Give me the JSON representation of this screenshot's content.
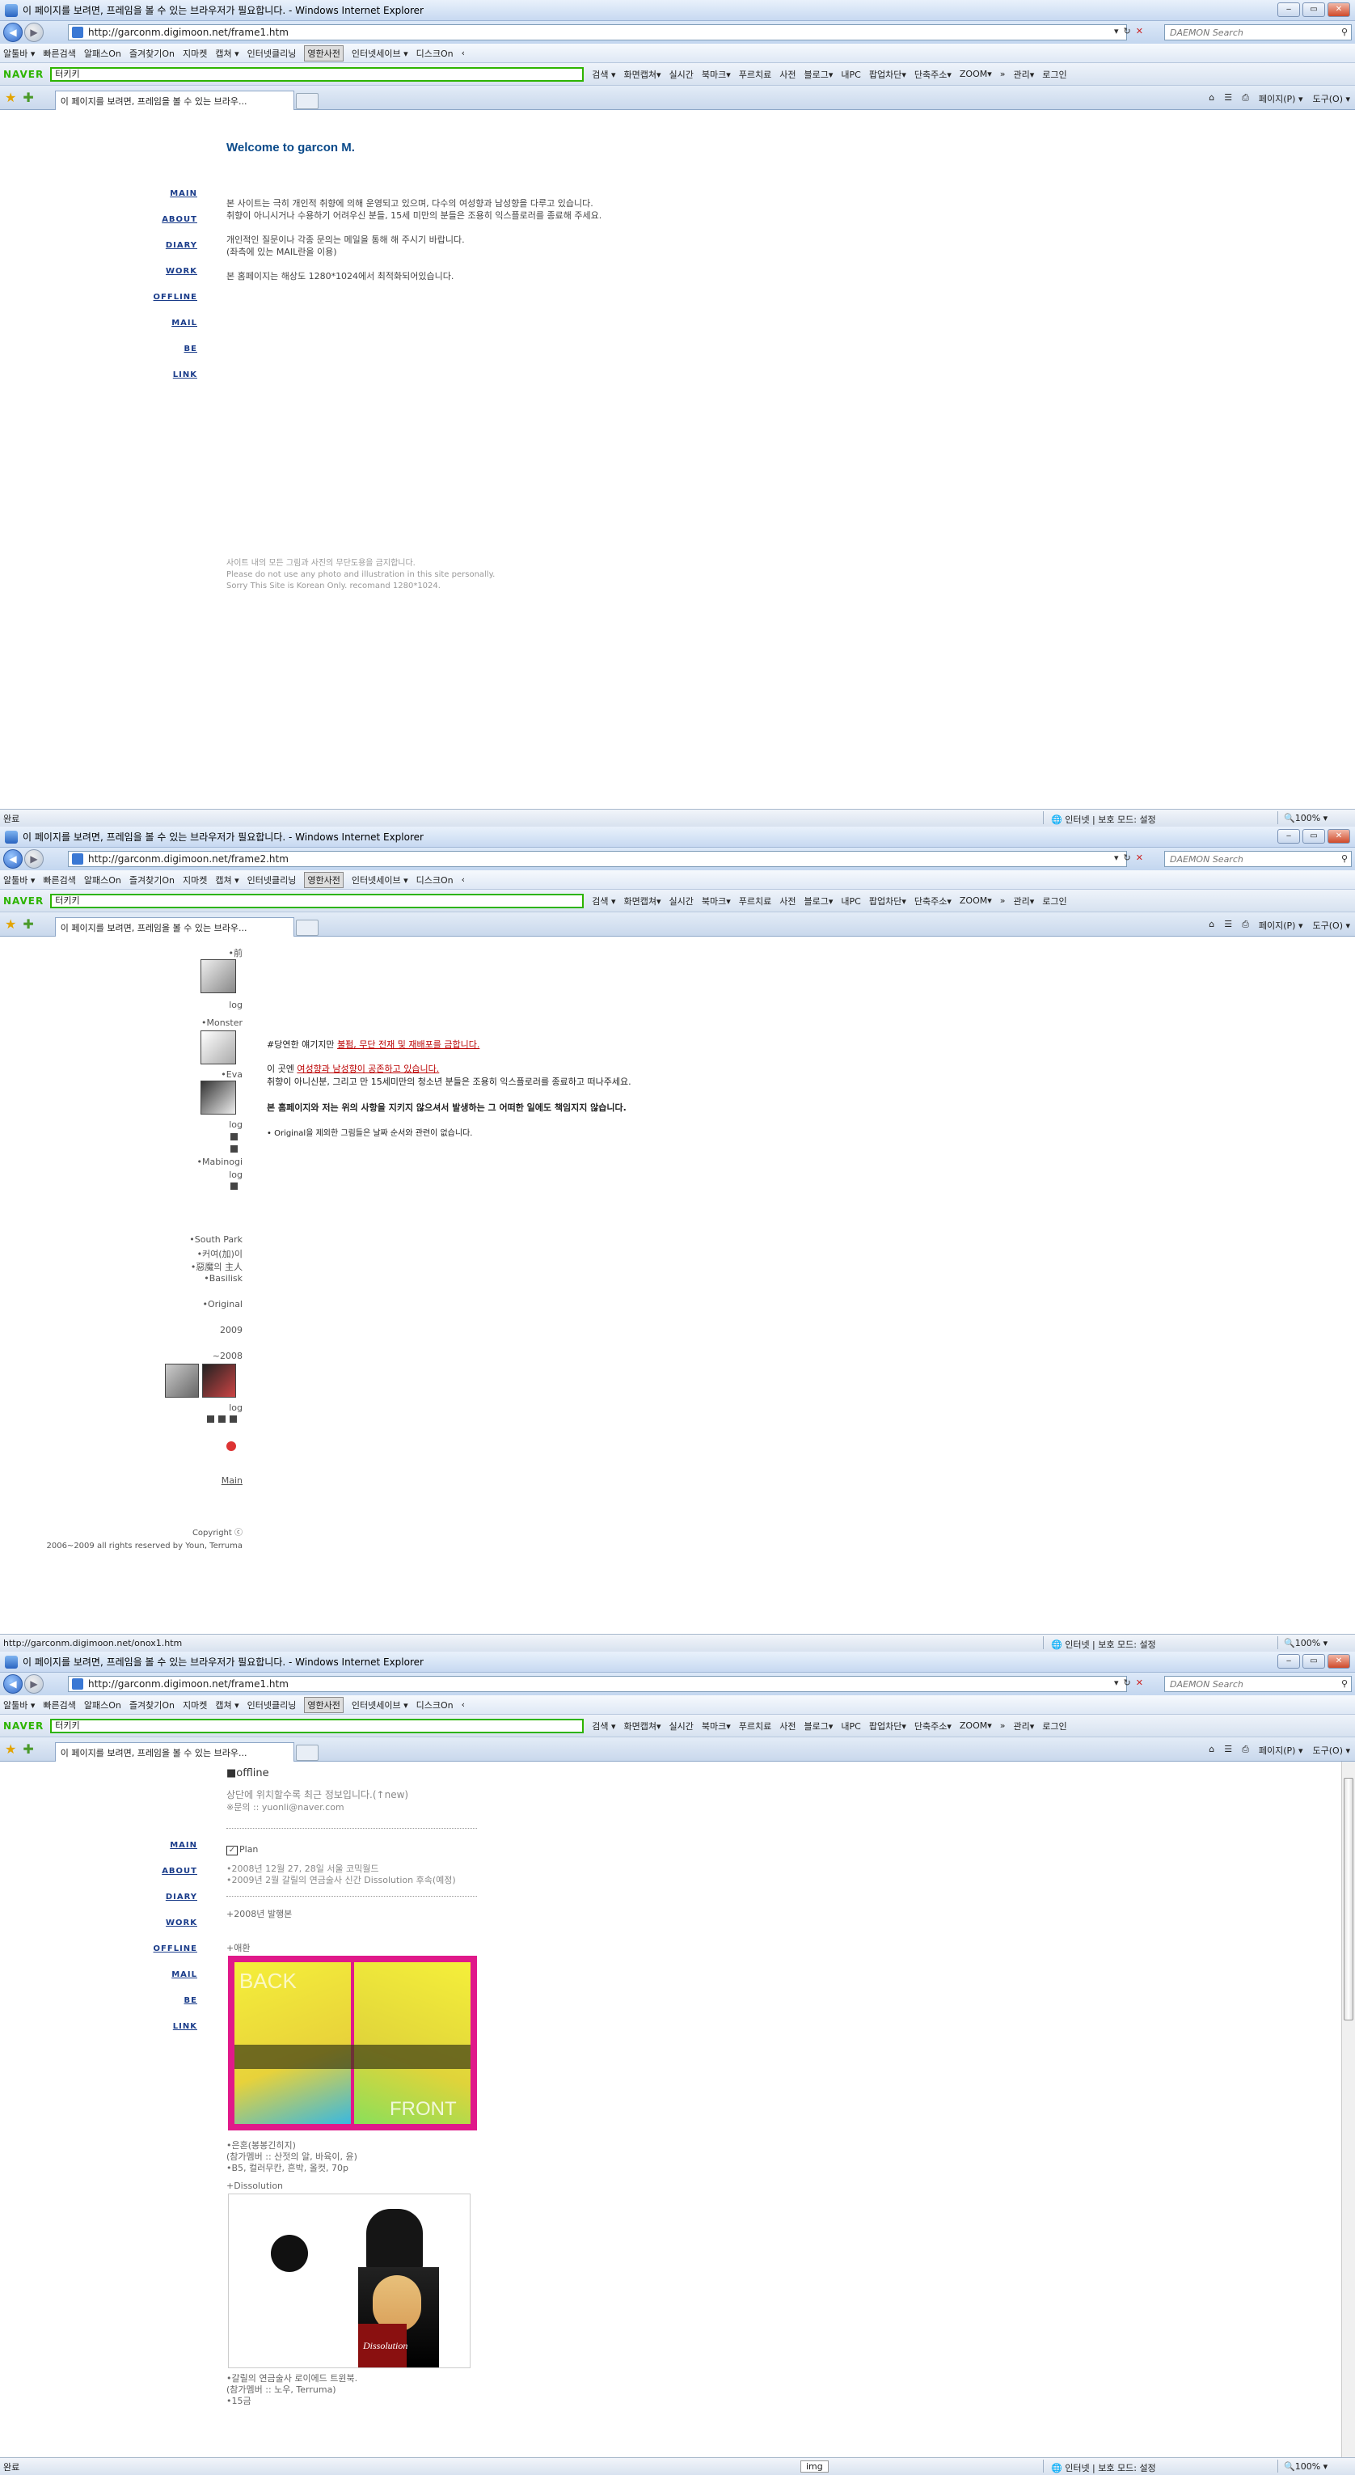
{
  "window1": {
    "title": "이 페이지를 보려면, 프레임을 볼 수 있는 브라우저가 필요합니다. - Windows Internet Explorer",
    "url": "http://garconm.digimoon.net/frame1.htm",
    "search_placeholder": "DAEMON Search",
    "tab_label": "이 페이지를 보려면, 프레임을 볼 수 있는 브라우...",
    "status_text": "완료",
    "zone": "인터넷 | 보호 모드: 설정",
    "zoom": "100%"
  },
  "window2": {
    "title": "이 페이지를 보려면, 프레임을 볼 수 있는 브라우저가 필요합니다. - Windows Internet Explorer",
    "url": "http://garconm.digimoon.net/frame2.htm",
    "search_placeholder": "DAEMON Search",
    "tab_label": "이 페이지를 보려면, 프레임을 볼 수 있는 브라우...",
    "status_text": "http://garconm.digimoon.net/onox1.htm",
    "zone": "인터넷 | 보호 모드: 설정",
    "zoom": "100%"
  },
  "window3": {
    "title": "이 페이지를 보려면, 프레임을 볼 수 있는 브라우저가 필요합니다. - Windows Internet Explorer",
    "url": "http://garconm.digimoon.net/frame1.htm",
    "search_placeholder": "DAEMON Search",
    "tab_label": "이 페이지를 보려면, 프레임을 볼 수 있는 브라우...",
    "status_text": "완료",
    "status_img": "img",
    "zone": "인터넷 | 보호 모드: 설정",
    "zoom": "100%"
  },
  "toolbar1": [
    "알툴바 ▾",
    "빠른검색",
    "알패스On",
    "즐겨찾기On",
    "지마켓",
    "캡쳐 ▾",
    "인터넷클리닝",
    "영한사전",
    "인터넷세이브 ▾",
    "디스크On",
    "‹"
  ],
  "toolbar2": {
    "brand": "NAVER",
    "query": "터키키",
    "items": [
      "검색 ▾",
      "화면캡쳐▾",
      "실시간",
      "북마크▾",
      "푸르치료",
      "사전",
      "블로그▾",
      "내PC",
      "팝업차단▾",
      "단축주소▾",
      "ZOOM▾",
      "»",
      "관리▾",
      "로그인"
    ]
  },
  "cmdbar": [
    "페이지(P) ▾",
    "도구(O) ▾"
  ],
  "menu": [
    "MAIN",
    "ABOUT",
    "DIARY",
    "WORK",
    "OFFLINE",
    "MAIL",
    "BE",
    "LINK"
  ],
  "page1": {
    "welcome": "Welcome to garcon M.",
    "para1": "본 사이트는 극히 개인적 취향에 의해 운영되고 있으며, 다수의 여성향과 남성향을 다루고 있습니다.",
    "para2": "취향이 아니시거나 수용하기 어려우신 분들, 15세 미만의 분들은 조용히 익스플로러를 종료해 주세요.",
    "para3": "개인적인 질문이나 각종 문의는 메일을 통해 해 주시기 바랍니다.",
    "para4": "(좌측에 있는 MAIL란을 이용)",
    "para5": "본 홈페이지는 해상도 1280*1024에서 최적화되어있습니다.",
    "foot1": "사이트 내의 모든 그림과 사진의 무단도용을 금지합니다.",
    "foot2": "Please do not use any photo and illustration in this site personally.",
    "foot3": "Sorry This Site is Korean Only. recomand 1280*1024."
  },
  "page2": {
    "left": {
      "l1": "•前",
      "l2": "log",
      "l3": "•Monster",
      "l4": "•Eva",
      "l5": "log",
      "l6": "•Mabinogi",
      "l7": "log",
      "l8": "•South Park",
      "l9": "•커여(加)이",
      "l10": "•惡魔의 主人",
      "l11": "•Basilisk",
      "l12": "•Original",
      "l13": "2009",
      "l14": "~2008",
      "l15": "log",
      "l16": "Main",
      "copy1": "Copyright ⓒ",
      "copy2": "2006~2009 all rights reserved by Youn, Terruma"
    },
    "notice1a": "#당연한 얘기지만 ",
    "notice1b": "불펌, 무단 전재 및 재배포를 금합니다.",
    "notice2a": "이 곳엔 ",
    "notice2b": "여성향과 남성향이 공존하고 있습니다.",
    "notice3": "취향이 아니신분, 그리고 만 15세미만의 청소년 분들은 조용히 익스플로러를 종료하고 떠나주세요.",
    "notice4": "본 홈페이지와 저는 위의 사항을 지키지 않으셔서 발생하는 그 어떠한 일에도 책임지지 않습니다.",
    "notice5": "• Original을 제외한 그림들은 날짜 순서와 관련이 없습니다."
  },
  "page3": {
    "heading": "■offline",
    "sub": "상단에 위치할수록 최근 정보입니다.(↑new)",
    "contact": "※문의 :: yuonli@naver.com",
    "plan": "Plan",
    "plan1": "•2008년 12월 27, 28일 서울 코믹월드",
    "plan2": "•2009년 2월 갈릴의 연금술사 신간 Dissolution 후속(예정)",
    "issue": "+2008년 발행본",
    "book1": "+애환",
    "book1_img_front": "FRONT",
    "book1_img_back": "BACK",
    "book1_d1": "•은혼(봉봉긴히지)",
    "book1_d2": "(참가멤버 :: 산젓의 알, 바육이, 윤)",
    "book1_d3": "•B5, 컬러무칸, 흔박, 올컷, 70p",
    "book2": "+Dissolution",
    "book2_img_title": "Dissolution",
    "book2_d1": "•갈릴의 연금술사 로이에드 트윈북.",
    "book2_d2": "(참가멤버 :: 노우, Terruma)",
    "book2_d3": "•15금"
  }
}
